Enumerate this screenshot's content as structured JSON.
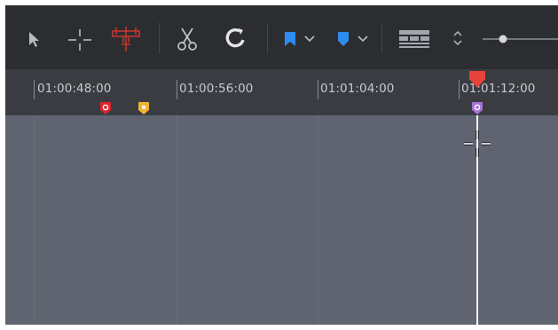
{
  "toolbar": {
    "tools": [
      {
        "icon": "selection-arrow-icon"
      },
      {
        "icon": "trim-edit-icon"
      },
      {
        "icon": "dynamic-trim-icon",
        "color": "#d9342b"
      },
      {
        "icon": "blade-scissors-icon"
      },
      {
        "icon": "snapping-magnet-icon"
      },
      {
        "icon": "flag-icon",
        "color": "#2d8cf0"
      },
      {
        "icon": "flag-dropdown-chevron-icon"
      },
      {
        "icon": "marker-icon",
        "color": "#2d8cf0"
      },
      {
        "icon": "marker-dropdown-chevron-icon"
      },
      {
        "icon": "timeline-view-options-icon"
      },
      {
        "icon": "zoom-toggle-icon"
      },
      {
        "icon": "zoom-slider-icon"
      }
    ]
  },
  "ruler": {
    "timecodes": [
      "01:00:48:00",
      "01:00:56:00",
      "01:01:04:00",
      "01:01:12:00"
    ],
    "markers": [
      {
        "color": "#e0242f",
        "icon": "marker-red-icon"
      },
      {
        "color": "#f2b233",
        "icon": "marker-yellow-icon"
      },
      {
        "color": "#a872d9",
        "icon": "marker-purple-icon"
      }
    ],
    "playhead_color": "#e8433a"
  }
}
